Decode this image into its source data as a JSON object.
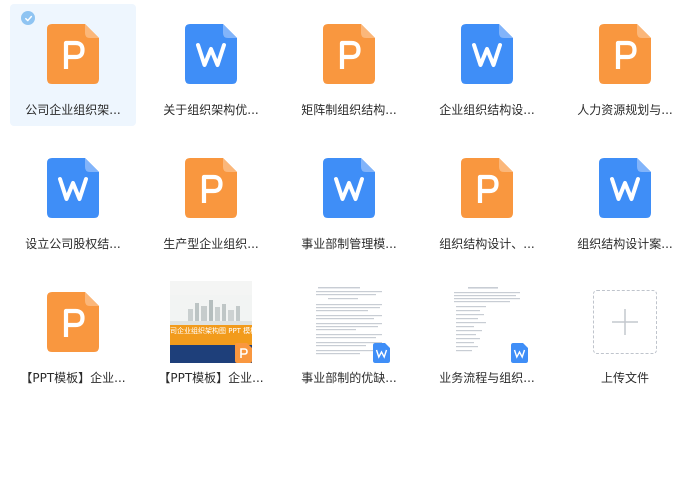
{
  "files": [
    {
      "name": "公司企业组织架...",
      "kind": "ppt",
      "selected": true,
      "icon": "ppt-file-icon"
    },
    {
      "name": "关于组织架构优...",
      "kind": "word",
      "icon": "word-file-icon"
    },
    {
      "name": "矩阵制组织结构...",
      "kind": "ppt",
      "icon": "ppt-file-icon"
    },
    {
      "name": "企业组织结构设...",
      "kind": "word",
      "icon": "word-file-icon"
    },
    {
      "name": "人力资源规划与...",
      "kind": "ppt",
      "icon": "ppt-file-icon"
    },
    {
      "name": "设立公司股权结...",
      "kind": "word",
      "icon": "word-file-icon"
    },
    {
      "name": "生产型企业组织...",
      "kind": "ppt",
      "icon": "ppt-file-icon"
    },
    {
      "name": "事业部制管理模...",
      "kind": "word",
      "icon": "word-file-icon"
    },
    {
      "name": "组织结构设计、...",
      "kind": "ppt",
      "icon": "ppt-file-icon"
    },
    {
      "name": "组织结构设计案...",
      "kind": "word",
      "icon": "word-file-icon"
    },
    {
      "name": "【PPT模板】企业...",
      "kind": "ppt",
      "icon": "ppt-file-icon"
    },
    {
      "name": "【PPT模板】企业...",
      "kind": "ppt-preview",
      "preview_text": "司企业组织架构图 PPT 模板",
      "icon": "ppt-badge-icon"
    },
    {
      "name": "事业部制的优缺...",
      "kind": "word-preview",
      "icon": "word-badge-icon"
    },
    {
      "name": "业务流程与组织...",
      "kind": "word-preview",
      "icon": "word-badge-icon"
    }
  ],
  "upload": {
    "label": "上传文件",
    "icon": "plus-icon"
  },
  "colors": {
    "ppt_orange": "#f9973f",
    "ppt_orange_light": "#fbb77a",
    "word_blue": "#3f8ef7",
    "word_blue_light": "#82b4fa",
    "selected_bg": "#eef6fe",
    "check_blue": "#8fc4f2"
  }
}
